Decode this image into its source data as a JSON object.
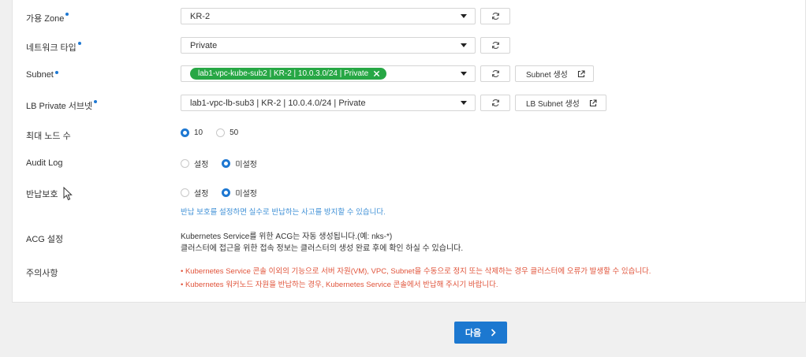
{
  "form": {
    "zone": {
      "label": "가용 Zone",
      "value": "KR-2"
    },
    "network_type": {
      "label": "네트워크 타입",
      "value": "Private"
    },
    "subnet": {
      "label": "Subnet",
      "tag": "lab1-vpc-kube-sub2 | KR-2 | 10.0.3.0/24 | Private",
      "create_button": "Subnet 생성"
    },
    "lb_private_subnet": {
      "label": "LB Private 서브넷",
      "value": "lab1-vpc-lb-sub3 | KR-2 | 10.0.4.0/24 | Private",
      "create_button": "LB Subnet 생성"
    },
    "max_nodes": {
      "label": "최대 노드 수",
      "options": [
        "10",
        "50"
      ],
      "selected": "10"
    },
    "audit_log": {
      "label": "Audit Log",
      "options": [
        "설정",
        "미설정"
      ],
      "selected": "미설정"
    },
    "return_protection": {
      "label": "반납보호",
      "options": [
        "설정",
        "미설정"
      ],
      "selected": "미설정",
      "hint": "반납 보호를 설정하면 실수로 반납하는 사고를 방지할 수 있습니다."
    },
    "acg": {
      "label": "ACG 설정",
      "line1": "Kubernetes Service를 위한 ACG는 자동 생성됩니다.(예: nks-*)",
      "line2": "클러스터에 접근을 위한 접속 정보는 클러스터의 생성 완료 후에 확인 하실 수 있습니다."
    },
    "notes": {
      "label": "주의사항",
      "items": [
        "• Kubernetes Service 콘솔 이외의 기능으로 서버 자원(VM), VPC, Subnet을 수동으로 정지 또는 삭제하는 경우 클러스터에 오류가 발생할 수 있습니다.",
        "• Kubernetes 워커노드 자원을 반납하는 경우, Kubernetes Service 콘솔에서 반납해 주시기 바랍니다."
      ]
    }
  },
  "footer": {
    "next_label": "다음"
  },
  "colors": {
    "accent": "#1e78d2",
    "tag_green": "#27a745",
    "warning": "#e0533a",
    "hint": "#3d8fd6"
  }
}
